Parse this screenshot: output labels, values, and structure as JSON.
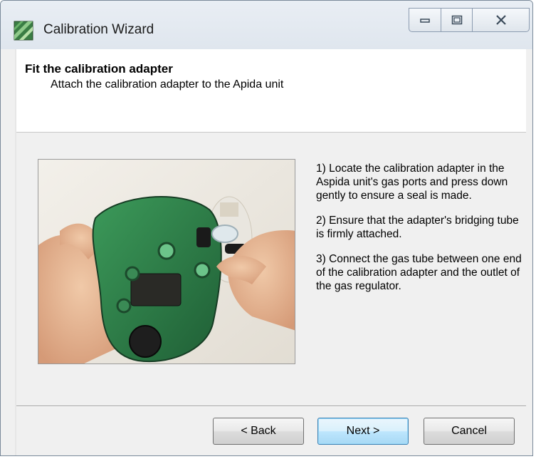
{
  "window": {
    "title": "Calibration Wizard",
    "icon": "calibration-wizard-icon",
    "controls": [
      "minimize-icon",
      "maximize-icon",
      "close-icon"
    ]
  },
  "header": {
    "title": "Fit the calibration adapter",
    "subtitle": "Attach the calibration adapter to the Apida unit"
  },
  "body": {
    "image": "photo of hands fitting calibration adapter onto green gas detector",
    "steps": [
      "1) Locate the calibration adapter in the Aspida unit's gas ports and press down gently to ensure a seal is made.",
      "2) Ensure that the adapter's bridging tube is firmly attached.",
      "3) Connect the gas tube between one end of the calibration adapter and the outlet of the gas regulator."
    ]
  },
  "buttons": {
    "back": "< Back",
    "next": "Next >",
    "cancel": "Cancel"
  },
  "colors": {
    "next_border": "#3c7fb1",
    "device_green": "#2f8a4c"
  }
}
